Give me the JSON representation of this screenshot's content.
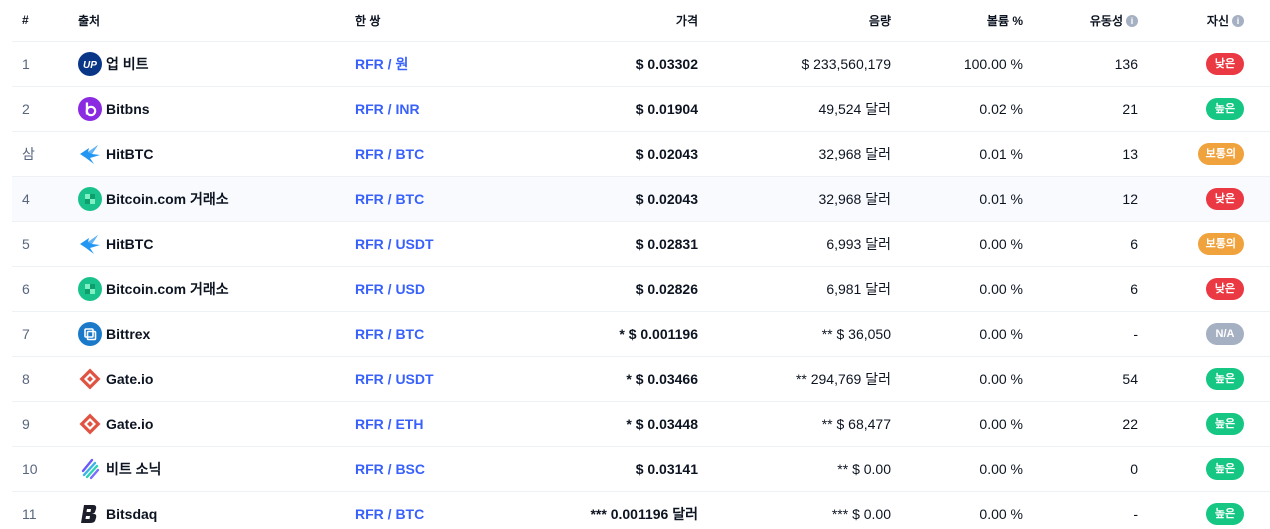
{
  "headers": {
    "rank": "#",
    "source": "출처",
    "pair": "한 쌍",
    "price": "가격",
    "volume": "음량",
    "volume_pct": "볼륨 %",
    "liquidity": "유동성",
    "confidence": "자신"
  },
  "colors": {
    "low": "#ea3943",
    "high": "#16c784",
    "medium": "#f0a23c",
    "na": "#a6b0c3",
    "link": "#3861fb"
  },
  "rows": [
    {
      "rank": "1",
      "exchange": "업 비트",
      "logo": "upbit-logo",
      "pair": "RFR / 원",
      "price": "$ 0.03302",
      "volume": "$ 233,560,179",
      "volume_pct": "100.00 %",
      "liquidity": "136",
      "confidence": "낮은",
      "level": "low"
    },
    {
      "rank": "2",
      "exchange": "Bitbns",
      "logo": "bitbns-logo",
      "pair": "RFR / INR",
      "price": "$ 0.01904",
      "volume": "49,524 달러",
      "volume_pct": "0.02 %",
      "liquidity": "21",
      "confidence": "높은",
      "level": "high"
    },
    {
      "rank": "삼",
      "exchange": "HitBTC",
      "logo": "hitbtc-logo",
      "pair": "RFR / BTC",
      "price": "$ 0.02043",
      "volume": "32,968 달러",
      "volume_pct": "0.01 %",
      "liquidity": "13",
      "confidence": "보통의",
      "level": "medium"
    },
    {
      "rank": "4",
      "exchange": "Bitcoin.com 거래소",
      "logo": "bitcoin-com-logo",
      "pair": "RFR / BTC",
      "price": "$ 0.02043",
      "volume": "32,968 달러",
      "volume_pct": "0.01 %",
      "liquidity": "12",
      "confidence": "낮은",
      "level": "low"
    },
    {
      "rank": "5",
      "exchange": "HitBTC",
      "logo": "hitbtc-logo",
      "pair": "RFR / USDT",
      "price": "$ 0.02831",
      "volume": "6,993 달러",
      "volume_pct": "0.00 %",
      "liquidity": "6",
      "confidence": "보통의",
      "level": "medium"
    },
    {
      "rank": "6",
      "exchange": "Bitcoin.com 거래소",
      "logo": "bitcoin-com-logo",
      "pair": "RFR / USD",
      "price": "$ 0.02826",
      "volume": "6,981 달러",
      "volume_pct": "0.00 %",
      "liquidity": "6",
      "confidence": "낮은",
      "level": "low"
    },
    {
      "rank": "7",
      "exchange": "Bittrex",
      "logo": "bittrex-logo",
      "pair": "RFR / BTC",
      "price": "* $ 0.001196",
      "volume": "** $ 36,050",
      "volume_pct": "0.00 %",
      "liquidity": "-",
      "confidence": "N/A",
      "level": "na"
    },
    {
      "rank": "8",
      "exchange": "Gate.io",
      "logo": "gateio-logo",
      "pair": "RFR / USDT",
      "price": "* $ 0.03466",
      "volume": "** 294,769 달러",
      "volume_pct": "0.00 %",
      "liquidity": "54",
      "confidence": "높은",
      "level": "high"
    },
    {
      "rank": "9",
      "exchange": "Gate.io",
      "logo": "gateio-logo",
      "pair": "RFR / ETH",
      "price": "* $ 0.03448",
      "volume": "** $ 68,477",
      "volume_pct": "0.00 %",
      "liquidity": "22",
      "confidence": "높은",
      "level": "high"
    },
    {
      "rank": "10",
      "exchange": "비트 소닉",
      "logo": "bitsonic-logo",
      "pair": "RFR / BSC",
      "price": "$ 0.03141",
      "volume": "** $ 0.00",
      "volume_pct": "0.00 %",
      "liquidity": "0",
      "confidence": "높은",
      "level": "high"
    },
    {
      "rank": "11",
      "exchange": "Bitsdaq",
      "logo": "bitsdaq-logo",
      "pair": "RFR / BTC",
      "price": "*** 0.001196 달러",
      "volume": "*** $ 0.00",
      "volume_pct": "0.00 %",
      "liquidity": "-",
      "confidence": "높은",
      "level": "high"
    }
  ]
}
